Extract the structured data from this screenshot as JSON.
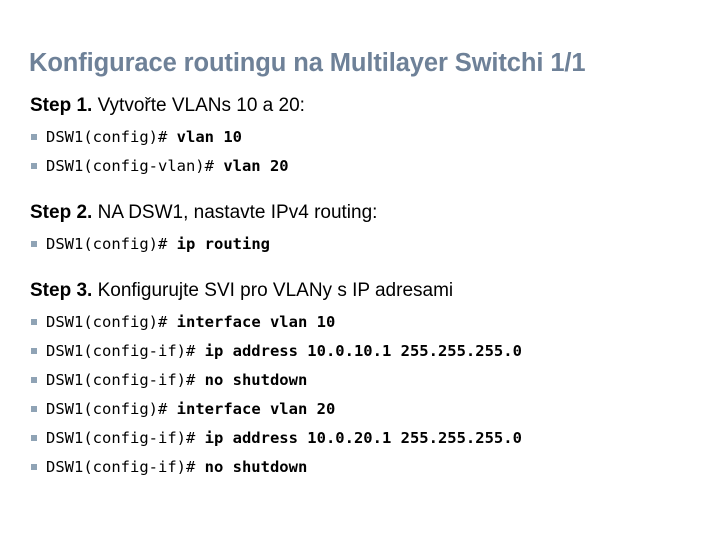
{
  "slide": {
    "title": "Konfigurace routingu na Multilayer Switchi 1/1",
    "title_color": "#6e8198",
    "bullet_color": "#8fa3b5",
    "background_color": "#ffffff",
    "text_color": "#000000"
  },
  "steps": [
    {
      "label": "Step 1.",
      "text": " Vytvořte VLANs 10 a 20:",
      "lines": [
        {
          "bullet": "square-bullet",
          "prompt": "DSW1(config)#",
          "command": " vlan 10"
        },
        {
          "bullet": "square-bullet",
          "prompt": "DSW1(config-vlan)#",
          "command": " vlan 20"
        }
      ]
    },
    {
      "label": "Step 2.",
      "text": " NA DSW1, nastavte IPv4 routing:",
      "lines": [
        {
          "bullet": "square-bullet",
          "prompt": "DSW1(config)#",
          "command": " ip routing"
        }
      ]
    },
    {
      "label": "Step 3.",
      "text": " Konfigurujte SVI pro VLANy s IP adresami",
      "lines": [
        {
          "bullet": "square-bullet",
          "prompt": "DSW1(config)#",
          "command": " interface vlan 10"
        },
        {
          "bullet": "square-bullet",
          "prompt": "DSW1(config-if)#",
          "command": " ip address 10.0.10.1 255.255.255.0"
        },
        {
          "bullet": "square-bullet",
          "prompt": "DSW1(config-if)#",
          "command": " no shutdown"
        },
        {
          "bullet": "square-bullet",
          "prompt": "DSW1(config)#",
          "command": " interface vlan 20"
        },
        {
          "bullet": "square-bullet",
          "prompt": "DSW1(config-if)#",
          "command": " ip address 10.0.20.1 255.255.255.0"
        },
        {
          "bullet": "square-bullet",
          "prompt": "DSW1(config-if)#",
          "command": " no shutdown"
        }
      ]
    }
  ]
}
